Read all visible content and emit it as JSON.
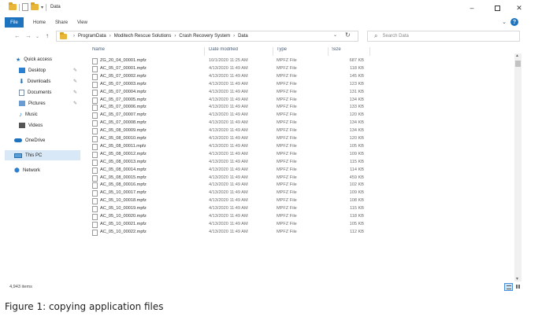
{
  "window": {
    "title": "Data",
    "controls": {
      "minimize": "–",
      "maximize": "",
      "close": "✕"
    }
  },
  "ribbon": {
    "file_tab": "File",
    "tabs": [
      "Home",
      "Share",
      "View"
    ],
    "collapse_chevron": "⌄",
    "help": "?"
  },
  "navigation": {
    "back": "←",
    "forward": "→",
    "recent": "⌄",
    "up": "↑",
    "breadcrumb": [
      "ProgramData",
      "Moditech Rescue Solutions",
      "Crash Recovery System",
      "Data"
    ],
    "breadcrumb_separator": "›",
    "dropdown": "⌄",
    "refresh": "↻",
    "search_placeholder": "Search Data"
  },
  "sidebar": {
    "items": [
      {
        "label": "Quick access",
        "icon": "star-icon",
        "pinned": false
      },
      {
        "label": "Desktop",
        "icon": "desktop-icon",
        "pinned": true
      },
      {
        "label": "Downloads",
        "icon": "download-icon",
        "pinned": true
      },
      {
        "label": "Documents",
        "icon": "documents-icon",
        "pinned": true
      },
      {
        "label": "Pictures",
        "icon": "pictures-icon",
        "pinned": true
      },
      {
        "label": "Music",
        "icon": "music-icon",
        "pinned": false
      },
      {
        "label": "Videos",
        "icon": "videos-icon",
        "pinned": false
      },
      {
        "label": "OneDrive",
        "icon": "onedrive-icon",
        "pinned": false
      },
      {
        "label": "This PC",
        "icon": "this-pc-icon",
        "pinned": false,
        "selected": true
      },
      {
        "label": "Network",
        "icon": "network-icon",
        "pinned": false
      }
    ],
    "pin_glyph": "✎"
  },
  "file_list": {
    "columns": [
      "Name",
      "Date modified",
      "Type",
      "Size"
    ],
    "sort_indicator": "^",
    "rows": [
      {
        "name": "ZG_20_04_00001.mpfz",
        "date": "10/1/2020 11:25 AM",
        "type": "MPFZ File",
        "size": "687 KB"
      },
      {
        "name": "AC_05_07_00001.mpfz",
        "date": "4/13/2020 11:49 AM",
        "type": "MPFZ File",
        "size": "118 KB"
      },
      {
        "name": "AC_05_07_00002.mpfz",
        "date": "4/13/2020 11:49 AM",
        "type": "MPFZ File",
        "size": "145 KB"
      },
      {
        "name": "AC_05_07_00003.mpfz",
        "date": "4/13/2020 11:49 AM",
        "type": "MPFZ File",
        "size": "123 KB"
      },
      {
        "name": "AC_05_07_00004.mpfz",
        "date": "4/13/2020 11:49 AM",
        "type": "MPFZ File",
        "size": "131 KB"
      },
      {
        "name": "AC_05_07_00005.mpfz",
        "date": "4/13/2020 11:49 AM",
        "type": "MPFZ File",
        "size": "134 KB"
      },
      {
        "name": "AC_05_07_00006.mpfz",
        "date": "4/13/2020 11:49 AM",
        "type": "MPFZ File",
        "size": "133 KB"
      },
      {
        "name": "AC_05_07_00007.mpfz",
        "date": "4/13/2020 11:49 AM",
        "type": "MPFZ File",
        "size": "120 KB"
      },
      {
        "name": "AC_05_07_00008.mpfz",
        "date": "4/13/2020 11:49 AM",
        "type": "MPFZ File",
        "size": "134 KB"
      },
      {
        "name": "AC_05_08_00009.mpfz",
        "date": "4/13/2020 11:49 AM",
        "type": "MPFZ File",
        "size": "134 KB"
      },
      {
        "name": "AC_05_08_00010.mpfz",
        "date": "4/13/2020 11:49 AM",
        "type": "MPFZ File",
        "size": "120 KB"
      },
      {
        "name": "AC_05_08_00011.mpfz",
        "date": "4/13/2020 11:49 AM",
        "type": "MPFZ File",
        "size": "105 KB"
      },
      {
        "name": "AC_05_08_00012.mpfz",
        "date": "4/13/2020 11:49 AM",
        "type": "MPFZ File",
        "size": "109 KB"
      },
      {
        "name": "AC_05_08_00013.mpfz",
        "date": "4/13/2020 11:49 AM",
        "type": "MPFZ File",
        "size": "115 KB"
      },
      {
        "name": "AC_05_08_00014.mpfz",
        "date": "4/13/2020 11:49 AM",
        "type": "MPFZ File",
        "size": "114 KB"
      },
      {
        "name": "AC_05_08_00015.mpfz",
        "date": "4/13/2020 11:49 AM",
        "type": "MPFZ File",
        "size": "459 KB"
      },
      {
        "name": "AC_05_08_00016.mpfz",
        "date": "4/13/2020 11:49 AM",
        "type": "MPFZ File",
        "size": "102 KB"
      },
      {
        "name": "AC_05_10_00017.mpfz",
        "date": "4/13/2020 11:49 AM",
        "type": "MPFZ File",
        "size": "109 KB"
      },
      {
        "name": "AC_05_10_00018.mpfz",
        "date": "4/13/2020 11:49 AM",
        "type": "MPFZ File",
        "size": "108 KB"
      },
      {
        "name": "AC_05_10_00019.mpfz",
        "date": "4/13/2020 11:49 AM",
        "type": "MPFZ File",
        "size": "115 KB"
      },
      {
        "name": "AC_05_10_00020.mpfz",
        "date": "4/13/2020 11:49 AM",
        "type": "MPFZ File",
        "size": "118 KB"
      },
      {
        "name": "AC_05_10_00021.mpfz",
        "date": "4/13/2020 11:49 AM",
        "type": "MPFZ File",
        "size": "105 KB"
      },
      {
        "name": "AC_05_10_00022.mpfz",
        "date": "4/13/2020 11:49 AM",
        "type": "MPFZ File",
        "size": "112 KB"
      }
    ]
  },
  "scrollbar": {
    "up": "▲",
    "down": "▼"
  },
  "status": {
    "item_count": "4,943 items"
  },
  "caption": "Figure 1: copying application files",
  "colors": {
    "accent": "#1e73be",
    "selected": "#d9e8f6",
    "folder": "#e8b73a"
  }
}
